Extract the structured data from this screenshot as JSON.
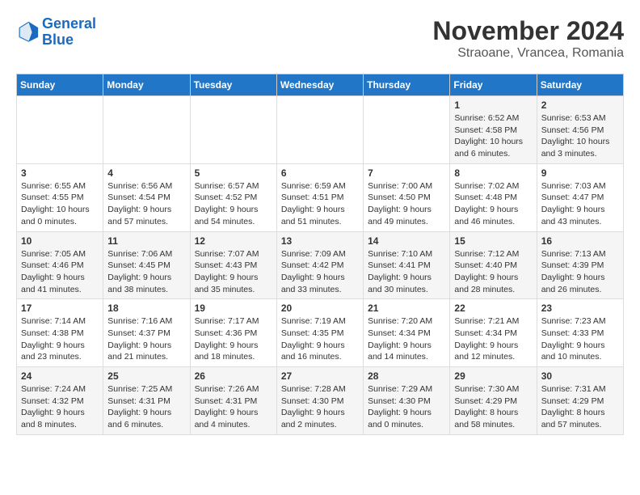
{
  "header": {
    "logo_line1": "General",
    "logo_line2": "Blue",
    "month_title": "November 2024",
    "location": "Straoane, Vrancea, Romania"
  },
  "weekdays": [
    "Sunday",
    "Monday",
    "Tuesday",
    "Wednesday",
    "Thursday",
    "Friday",
    "Saturday"
  ],
  "weeks": [
    [
      {
        "day": "",
        "info": ""
      },
      {
        "day": "",
        "info": ""
      },
      {
        "day": "",
        "info": ""
      },
      {
        "day": "",
        "info": ""
      },
      {
        "day": "",
        "info": ""
      },
      {
        "day": "1",
        "info": "Sunrise: 6:52 AM\nSunset: 4:58 PM\nDaylight: 10 hours\nand 6 minutes."
      },
      {
        "day": "2",
        "info": "Sunrise: 6:53 AM\nSunset: 4:56 PM\nDaylight: 10 hours\nand 3 minutes."
      }
    ],
    [
      {
        "day": "3",
        "info": "Sunrise: 6:55 AM\nSunset: 4:55 PM\nDaylight: 10 hours\nand 0 minutes."
      },
      {
        "day": "4",
        "info": "Sunrise: 6:56 AM\nSunset: 4:54 PM\nDaylight: 9 hours\nand 57 minutes."
      },
      {
        "day": "5",
        "info": "Sunrise: 6:57 AM\nSunset: 4:52 PM\nDaylight: 9 hours\nand 54 minutes."
      },
      {
        "day": "6",
        "info": "Sunrise: 6:59 AM\nSunset: 4:51 PM\nDaylight: 9 hours\nand 51 minutes."
      },
      {
        "day": "7",
        "info": "Sunrise: 7:00 AM\nSunset: 4:50 PM\nDaylight: 9 hours\nand 49 minutes."
      },
      {
        "day": "8",
        "info": "Sunrise: 7:02 AM\nSunset: 4:48 PM\nDaylight: 9 hours\nand 46 minutes."
      },
      {
        "day": "9",
        "info": "Sunrise: 7:03 AM\nSunset: 4:47 PM\nDaylight: 9 hours\nand 43 minutes."
      }
    ],
    [
      {
        "day": "10",
        "info": "Sunrise: 7:05 AM\nSunset: 4:46 PM\nDaylight: 9 hours\nand 41 minutes."
      },
      {
        "day": "11",
        "info": "Sunrise: 7:06 AM\nSunset: 4:45 PM\nDaylight: 9 hours\nand 38 minutes."
      },
      {
        "day": "12",
        "info": "Sunrise: 7:07 AM\nSunset: 4:43 PM\nDaylight: 9 hours\nand 35 minutes."
      },
      {
        "day": "13",
        "info": "Sunrise: 7:09 AM\nSunset: 4:42 PM\nDaylight: 9 hours\nand 33 minutes."
      },
      {
        "day": "14",
        "info": "Sunrise: 7:10 AM\nSunset: 4:41 PM\nDaylight: 9 hours\nand 30 minutes."
      },
      {
        "day": "15",
        "info": "Sunrise: 7:12 AM\nSunset: 4:40 PM\nDaylight: 9 hours\nand 28 minutes."
      },
      {
        "day": "16",
        "info": "Sunrise: 7:13 AM\nSunset: 4:39 PM\nDaylight: 9 hours\nand 26 minutes."
      }
    ],
    [
      {
        "day": "17",
        "info": "Sunrise: 7:14 AM\nSunset: 4:38 PM\nDaylight: 9 hours\nand 23 minutes."
      },
      {
        "day": "18",
        "info": "Sunrise: 7:16 AM\nSunset: 4:37 PM\nDaylight: 9 hours\nand 21 minutes."
      },
      {
        "day": "19",
        "info": "Sunrise: 7:17 AM\nSunset: 4:36 PM\nDaylight: 9 hours\nand 18 minutes."
      },
      {
        "day": "20",
        "info": "Sunrise: 7:19 AM\nSunset: 4:35 PM\nDaylight: 9 hours\nand 16 minutes."
      },
      {
        "day": "21",
        "info": "Sunrise: 7:20 AM\nSunset: 4:34 PM\nDaylight: 9 hours\nand 14 minutes."
      },
      {
        "day": "22",
        "info": "Sunrise: 7:21 AM\nSunset: 4:34 PM\nDaylight: 9 hours\nand 12 minutes."
      },
      {
        "day": "23",
        "info": "Sunrise: 7:23 AM\nSunset: 4:33 PM\nDaylight: 9 hours\nand 10 minutes."
      }
    ],
    [
      {
        "day": "24",
        "info": "Sunrise: 7:24 AM\nSunset: 4:32 PM\nDaylight: 9 hours\nand 8 minutes."
      },
      {
        "day": "25",
        "info": "Sunrise: 7:25 AM\nSunset: 4:31 PM\nDaylight: 9 hours\nand 6 minutes."
      },
      {
        "day": "26",
        "info": "Sunrise: 7:26 AM\nSunset: 4:31 PM\nDaylight: 9 hours\nand 4 minutes."
      },
      {
        "day": "27",
        "info": "Sunrise: 7:28 AM\nSunset: 4:30 PM\nDaylight: 9 hours\nand 2 minutes."
      },
      {
        "day": "28",
        "info": "Sunrise: 7:29 AM\nSunset: 4:30 PM\nDaylight: 9 hours\nand 0 minutes."
      },
      {
        "day": "29",
        "info": "Sunrise: 7:30 AM\nSunset: 4:29 PM\nDaylight: 8 hours\nand 58 minutes."
      },
      {
        "day": "30",
        "info": "Sunrise: 7:31 AM\nSunset: 4:29 PM\nDaylight: 8 hours\nand 57 minutes."
      }
    ]
  ]
}
